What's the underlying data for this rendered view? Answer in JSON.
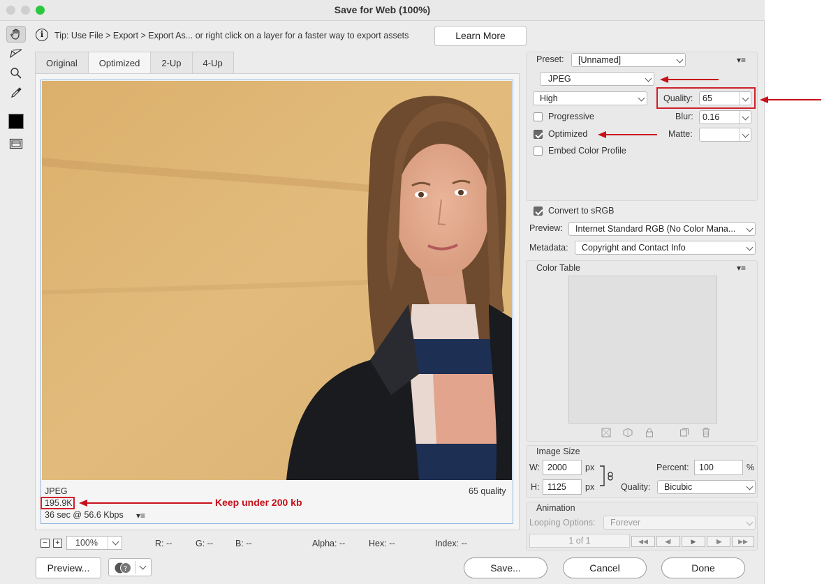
{
  "window": {
    "title": "Save for Web (100%)"
  },
  "tip": {
    "text": "Tip: Use File > Export > Export As...  or right click on a layer for a faster way to export assets",
    "learn_more": "Learn More"
  },
  "tabs": [
    "Original",
    "Optimized",
    "2-Up",
    "4-Up"
  ],
  "image_info": {
    "format": "JPEG",
    "size": "195.9K",
    "time": "36 sec @ 56.6 Kbps",
    "quality": "65 quality"
  },
  "annotations": {
    "size_note": "Keep under 200 kb"
  },
  "status": {
    "zoom": "100%",
    "r": "R: --",
    "g": "G: --",
    "b": "B: --",
    "alpha": "Alpha: --",
    "hex": "Hex: --",
    "index": "Index: --"
  },
  "settings": {
    "preset_label": "Preset:",
    "preset_value": "[Unnamed]",
    "format": "JPEG",
    "compression": "High",
    "quality_label": "Quality:",
    "quality_value": "65",
    "progressive": "Progressive",
    "blur_label": "Blur:",
    "blur_value": "0.16",
    "optimized": "Optimized",
    "matte_label": "Matte:",
    "embed_profile": "Embed Color Profile",
    "convert_srgb": "Convert to sRGB",
    "preview_label": "Preview:",
    "preview_value": "Internet Standard RGB (No Color Mana...",
    "metadata_label": "Metadata:",
    "metadata_value": "Copyright and Contact Info",
    "color_table": "Color Table"
  },
  "image_size": {
    "title": "Image Size",
    "w_label": "W:",
    "w_value": "2000",
    "h_label": "H:",
    "h_value": "1125",
    "px": "px",
    "percent_label": "Percent:",
    "percent_value": "100",
    "percent_unit": "%",
    "quality_label": "Quality:",
    "quality_value": "Bicubic"
  },
  "animation": {
    "title": "Animation",
    "looping_label": "Looping Options:",
    "looping_value": "Forever",
    "frame": "1 of 1"
  },
  "buttons": {
    "preview": "Preview...",
    "save": "Save...",
    "cancel": "Cancel",
    "done": "Done"
  },
  "colors": {
    "annotation_red": "#c8101a",
    "selection_blue": "#8fb4de"
  }
}
